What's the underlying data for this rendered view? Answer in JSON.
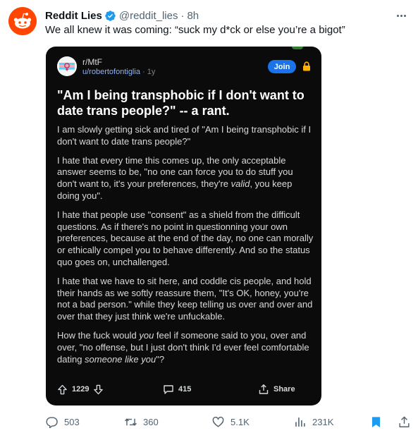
{
  "tweet": {
    "author_name": "Reddit Lies",
    "handle": "@reddit_lies",
    "separator": "·",
    "time": "8h",
    "text": "We all knew it was coming: “suck my d*ck or else you’re a bigot”",
    "avatar_icon": "reddit-logo-icon",
    "verified_icon": "verified-badge-icon",
    "brand_color": "#ff4500",
    "verified_color": "#1d9bf0"
  },
  "embed": {
    "subreddit": "r/MtF",
    "user": "u/robertofontiglia",
    "age": "· 1y",
    "join_label": "Join",
    "title": "\"Am I being transphobic if I don't want to date trans people?\" -- a rant.",
    "paragraphs": [
      [
        {
          "t": "I am slowly getting sick and tired of \"Am I being transphobic if I don't want to date trans people?\""
        }
      ],
      [
        {
          "t": "I hate that every time this comes up, the only acceptable answer seems to be, \"no one can force you to do stuff you don't want to, it's your preferences, they're "
        },
        {
          "t": "valid",
          "i": true
        },
        {
          "t": ", you keep doing you\"."
        }
      ],
      [
        {
          "t": "I hate that people use \"consent\" as a shield from the difficult questions. As if there's no point in questionning your own preferences, because at the end of the day, no one can morally or ethically compel you to behave differently. And so the status quo goes on, unchallenged."
        }
      ],
      [
        {
          "t": "I hate that we have to sit here, and coddle cis people, and hold their hands as we softly reassure them, \"It's OK, honey, you're not a bad person.\" while they keep telling us over and over and over that they just think we're unfuckable."
        }
      ],
      [
        {
          "t": "How the fuck would "
        },
        {
          "t": "you",
          "i": true
        },
        {
          "t": " feel if someone said to you, over and over, \"no offense, but I just don't think I'd ever feel comfortable dating "
        },
        {
          "t": "someone like you",
          "i": true
        },
        {
          "t": "\"?"
        }
      ]
    ],
    "upvotes": "1229",
    "comments": "415",
    "share_label": "Share"
  },
  "actions": {
    "replies": "503",
    "retweets": "360",
    "likes": "5.1K",
    "views": "231K"
  }
}
